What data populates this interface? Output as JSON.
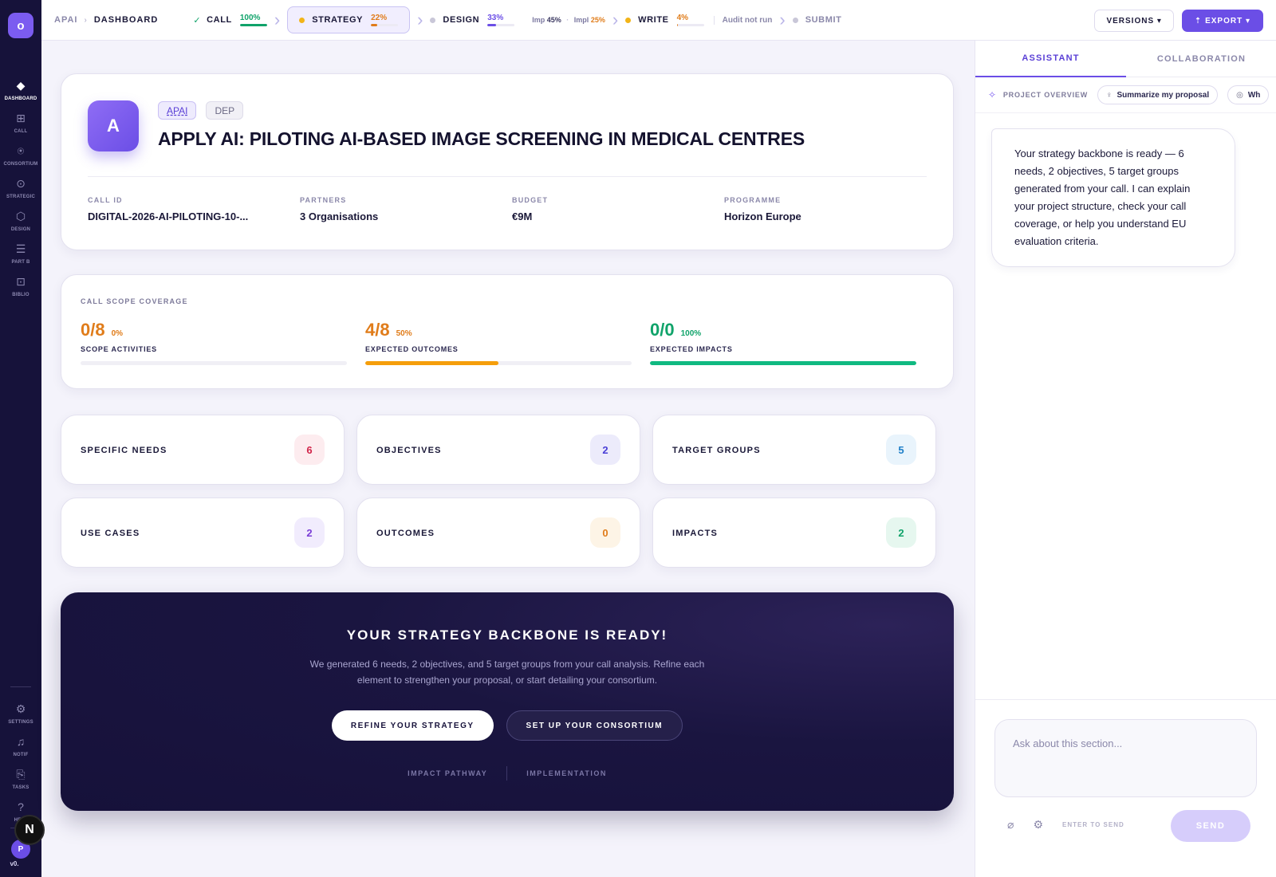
{
  "rail": {
    "logo": "o",
    "items": [
      {
        "label": "Dashboard",
        "icon": "diamond-icon",
        "glyph": "◆"
      },
      {
        "label": "Call",
        "icon": "grid-icon",
        "glyph": "⊞"
      },
      {
        "label": "Consortium",
        "icon": "network-icon",
        "glyph": "⍟"
      },
      {
        "label": "Strategic",
        "icon": "target-icon",
        "glyph": "⊙"
      },
      {
        "label": "Design",
        "icon": "hexagon-icon",
        "glyph": "⬡"
      },
      {
        "label": "Part B",
        "icon": "list-icon",
        "glyph": "☰"
      },
      {
        "label": "Biblio",
        "icon": "book-icon",
        "glyph": "⊡"
      }
    ],
    "bottom": [
      {
        "label": "Settings",
        "icon": "gear-icon",
        "glyph": "⚙"
      },
      {
        "label": "Notif",
        "icon": "bell-icon",
        "glyph": "♫"
      },
      {
        "label": "Tasks",
        "icon": "clipboard-icon",
        "glyph": "⎘"
      },
      {
        "label": "Help",
        "icon": "question-icon",
        "glyph": "?"
      }
    ],
    "avatar": "P",
    "version": "v0.",
    "n_badge": "N"
  },
  "topbar": {
    "crumb_project": "APAI",
    "crumb_sep": "›",
    "crumb_page": "DASHBOARD",
    "steps": {
      "call": {
        "mark": "✓",
        "label": "CALL",
        "pct": "100%",
        "value": 100,
        "color": "#10a36a"
      },
      "strategy": {
        "label": "STRATEGY",
        "pct": "22%",
        "value": 22,
        "color": "#e07c1a"
      },
      "design": {
        "label": "DESIGN",
        "pct": "33%",
        "value": 33,
        "color": "#6b4ee6",
        "mini1_label": "Imp",
        "mini1_value": "45%",
        "mini_sep": "·",
        "mini2_label": "Impl",
        "mini2_value": "25%"
      },
      "write": {
        "label": "WRITE",
        "pct": "4%",
        "value": 4,
        "color": "#e07c1a",
        "audit": "Audit not run"
      },
      "submit": {
        "label": "SUBMIT"
      }
    },
    "chevron": "›",
    "versions_label": "VERSIONS ▾",
    "export_label": "⇡ EXPORT ▾"
  },
  "hero": {
    "avatar_letter": "A",
    "tag_primary": "APAI",
    "tag_secondary": "DEP",
    "title": "APPLY AI: PILOTING AI-BASED IMAGE SCREENING IN MEDICAL CENTRES",
    "meta": [
      {
        "label": "CALL ID",
        "value": "DIGITAL-2026-AI-PILOTING-10-..."
      },
      {
        "label": "PARTNERS",
        "value": "3 Organisations"
      },
      {
        "label": "BUDGET",
        "value": "€9M"
      },
      {
        "label": "PROGRAMME",
        "value": "Horizon Europe"
      }
    ]
  },
  "scope": {
    "title": "CALL SCOPE COVERAGE",
    "items": [
      {
        "count": "0/8",
        "pct": "0%",
        "value": 0,
        "label": "SCOPE ACTIVITIES",
        "color": "#e07c1a"
      },
      {
        "count": "4/8",
        "pct": "50%",
        "value": 50,
        "label": "EXPECTED OUTCOMES",
        "color": "#e07c1a"
      },
      {
        "count": "0/0",
        "pct": "100%",
        "value": 100,
        "label": "EXPECTED IMPACTS",
        "color": "#10a36a"
      }
    ]
  },
  "stats": [
    {
      "label": "SPECIFIC NEEDS",
      "count": "6",
      "fg": "#d1254a",
      "bg": "#fdecef"
    },
    {
      "label": "OBJECTIVES",
      "count": "2",
      "fg": "#4a3fd6",
      "bg": "#ecebfb"
    },
    {
      "label": "TARGET GROUPS",
      "count": "5",
      "fg": "#1f7fc8",
      "bg": "#e9f4fc"
    },
    {
      "label": "USE CASES",
      "count": "2",
      "fg": "#7b3fd6",
      "bg": "#f1ecfd"
    },
    {
      "label": "OUTCOMES",
      "count": "0",
      "fg": "#e07c1a",
      "bg": "#fdf4e6"
    },
    {
      "label": "IMPACTS",
      "count": "2",
      "fg": "#10a36a",
      "bg": "#e6f7ef"
    }
  ],
  "cta": {
    "title": "YOUR STRATEGY BACKBONE IS READY!",
    "text": "We generated 6 needs, 2 objectives, and 5 target groups from your call analysis. Refine each element to strengthen your proposal, or start detailing your consortium.",
    "primary": "REFINE YOUR STRATEGY",
    "secondary": "SET UP YOUR CONSORTIUM",
    "link1": "IMPACT PATHWAY",
    "link2": "IMPLEMENTATION"
  },
  "side": {
    "tab1": "ASSISTANT",
    "tab2": "COLLABORATION",
    "overview_label": "PROJECT OVERVIEW",
    "chip1": "Summarize my proposal",
    "chip2": "Wh",
    "message": "Your strategy backbone is ready — 6 needs, 2 objectives, 5 target groups generated from your call. I can explain your project structure, check your call coverage, or help you understand EU evaluation criteria.",
    "placeholder": "Ask about this section...",
    "hint": "ENTER TO SEND",
    "send": "SEND"
  },
  "colors": {
    "accent": "#6b4ee6",
    "rail": "#16123a"
  }
}
